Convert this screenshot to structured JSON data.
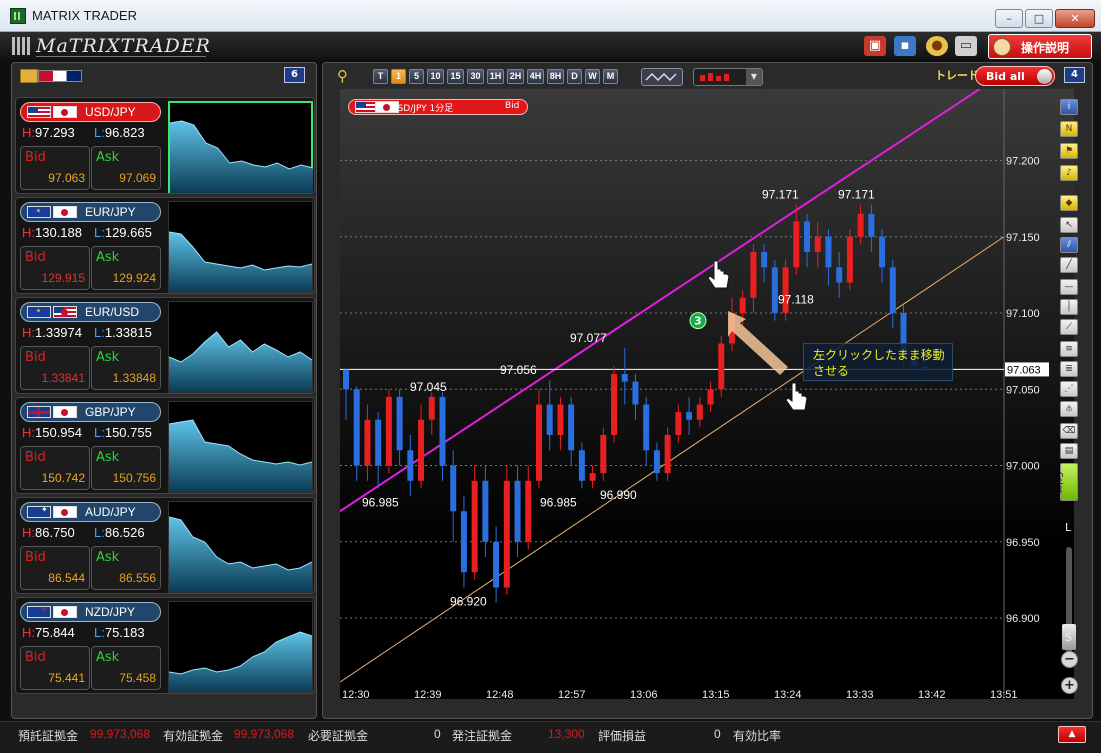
{
  "window": {
    "title": "MATRIX TRADER",
    "minimize": "–",
    "maximize": "□",
    "close": "✕"
  },
  "toolbar": {
    "logo": "MaTRIXTRADER",
    "help_label": "操作説明"
  },
  "left_panel": {
    "count": "6",
    "pairs": [
      {
        "name": "USD/JPY",
        "flag1": "us",
        "flag2": "jp",
        "high": "97.293",
        "low": "96.823",
        "bid": "97.063",
        "ask": "97.069",
        "selected": true
      },
      {
        "name": "EUR/JPY",
        "flag1": "eu",
        "flag2": "jp",
        "high": "130.188",
        "low": "129.665",
        "bid": "129.915",
        "ask": "129.924"
      },
      {
        "name": "EUR/USD",
        "flag1": "eu",
        "flag2": "us",
        "high": "1.33974",
        "low": "1.33815",
        "bid": "1.33841",
        "ask": "1.33848"
      },
      {
        "name": "GBP/JPY",
        "flag1": "gb",
        "flag2": "jp",
        "high": "150.954",
        "low": "150.755",
        "bid": "150.742",
        "ask": "150.756"
      },
      {
        "name": "AUD/JPY",
        "flag1": "au",
        "flag2": "jp",
        "high": "86.750",
        "low": "86.526",
        "bid": "86.544",
        "ask": "86.556"
      },
      {
        "name": "NZD/JPY",
        "flag1": "nz",
        "flag2": "jp",
        "high": "75.844",
        "low": "75.183",
        "bid": "75.441",
        "ask": "75.458"
      }
    ],
    "labels": {
      "high": "H:",
      "low": "L:",
      "bid": "Bid",
      "ask": "Ask"
    }
  },
  "chart_toolbar": {
    "timeframes": [
      "T",
      "1",
      "5",
      "10",
      "15",
      "30",
      "1H",
      "2H",
      "4H",
      "8H",
      "D",
      "W",
      "M"
    ],
    "active_timeframe": "1",
    "trade_label": "トレード",
    "bid_all_label": "Bid all",
    "count": "4"
  },
  "chart": {
    "tag_text": "USD/JPY 1分足",
    "tag_side": "Bid",
    "hint": "左クリックしたまま移動させる",
    "badge": "3",
    "zoom_l": "L",
    "zoom_s": "S"
  },
  "chart_data": {
    "type": "candlestick",
    "title": "USD/JPY 1分足",
    "y_axis": {
      "ticks": [
        "97.200",
        "97.150",
        "97.100",
        "97.050",
        "97.000",
        "96.950",
        "96.900"
      ],
      "ylim": [
        96.86,
        97.26
      ]
    },
    "x_axis": {
      "ticks": [
        "12:30",
        "12:39",
        "12:48",
        "12:57",
        "13:06",
        "13:15",
        "13:24",
        "13:33",
        "13:42",
        "13:51"
      ]
    },
    "current_price": "97.063",
    "annotations": [
      {
        "text": "97.045",
        "value": 97.045
      },
      {
        "text": "96.985",
        "value": 96.985
      },
      {
        "text": "97.056",
        "value": 97.056
      },
      {
        "text": "96.920",
        "value": 96.92
      },
      {
        "text": "97.077",
        "value": 97.077
      },
      {
        "text": "96.985",
        "value": 96.985
      },
      {
        "text": "96.990",
        "value": 96.99
      },
      {
        "text": "97.171",
        "value": 97.171
      },
      {
        "text": "97.118",
        "value": 97.118
      },
      {
        "text": "97.171",
        "value": 97.171
      }
    ],
    "candles": [
      [
        97.063,
        97.05,
        97.03,
        97.06
      ],
      [
        97.05,
        97.0,
        96.99,
        97.052
      ],
      [
        97.0,
        97.03,
        96.99,
        97.04
      ],
      [
        97.03,
        97.0,
        96.985,
        97.035
      ],
      [
        97.0,
        97.045,
        96.995,
        97.05
      ],
      [
        97.045,
        97.01,
        97.0,
        97.05
      ],
      [
        97.01,
        96.99,
        96.98,
        97.02
      ],
      [
        96.99,
        97.03,
        96.985,
        97.04
      ],
      [
        97.03,
        97.045,
        97.02,
        97.048
      ],
      [
        97.045,
        97.0,
        96.99,
        97.048
      ],
      [
        97.0,
        96.97,
        96.95,
        97.01
      ],
      [
        96.97,
        96.93,
        96.92,
        96.98
      ],
      [
        96.93,
        96.99,
        96.925,
        97.0
      ],
      [
        96.99,
        96.95,
        96.94,
        97.0
      ],
      [
        96.95,
        96.92,
        96.91,
        96.96
      ],
      [
        96.92,
        96.99,
        96.915,
        97.0
      ],
      [
        96.99,
        96.95,
        96.94,
        97.0
      ],
      [
        96.95,
        96.99,
        96.945,
        97.0
      ],
      [
        96.99,
        97.04,
        96.985,
        97.05
      ],
      [
        97.04,
        97.02,
        97.01,
        97.056
      ],
      [
        97.02,
        97.04,
        97.01,
        97.045
      ],
      [
        97.04,
        97.01,
        97.0,
        97.045
      ],
      [
        97.01,
        96.99,
        96.985,
        97.015
      ],
      [
        96.99,
        96.995,
        96.985,
        97.0
      ],
      [
        96.995,
        97.02,
        96.99,
        97.025
      ],
      [
        97.02,
        97.06,
        97.015,
        97.065
      ],
      [
        97.06,
        97.055,
        97.04,
        97.077
      ],
      [
        97.055,
        97.04,
        97.03,
        97.06
      ],
      [
        97.04,
        97.01,
        97.0,
        97.045
      ],
      [
        97.01,
        96.995,
        96.99,
        97.015
      ],
      [
        96.995,
        97.02,
        96.99,
        97.025
      ],
      [
        97.02,
        97.035,
        97.015,
        97.04
      ],
      [
        97.035,
        97.03,
        97.02,
        97.045
      ],
      [
        97.03,
        97.04,
        97.025,
        97.045
      ],
      [
        97.04,
        97.05,
        97.035,
        97.055
      ],
      [
        97.05,
        97.08,
        97.045,
        97.085
      ],
      [
        97.08,
        97.1,
        97.075,
        97.11
      ],
      [
        97.1,
        97.11,
        97.09,
        97.115
      ],
      [
        97.11,
        97.14,
        97.1,
        97.145
      ],
      [
        97.14,
        97.13,
        97.12,
        97.145
      ],
      [
        97.13,
        97.1,
        97.095,
        97.135
      ],
      [
        97.1,
        97.13,
        97.095,
        97.135
      ],
      [
        97.13,
        97.16,
        97.125,
        97.171
      ],
      [
        97.16,
        97.14,
        97.13,
        97.165
      ],
      [
        97.14,
        97.15,
        97.13,
        97.16
      ],
      [
        97.15,
        97.13,
        97.118,
        97.155
      ],
      [
        97.13,
        97.12,
        97.11,
        97.14
      ],
      [
        97.12,
        97.15,
        97.115,
        97.155
      ],
      [
        97.15,
        97.165,
        97.145,
        97.171
      ],
      [
        97.165,
        97.15,
        97.14,
        97.171
      ],
      [
        97.15,
        97.13,
        97.12,
        97.155
      ],
      [
        97.13,
        97.1,
        97.09,
        97.135
      ],
      [
        97.1,
        97.07,
        97.065,
        97.105
      ],
      [
        97.07,
        97.065,
        97.06,
        97.075
      ],
      [
        97.065,
        97.063,
        97.06,
        97.07
      ]
    ]
  },
  "status_bar": {
    "deposit_label": "預託証拠金",
    "deposit_value": "99,973,068",
    "valid_label": "有効証拠金",
    "valid_value": "99,973,068",
    "required_label": "必要証拠金",
    "required_value": "0",
    "ordered_label": "発注証拠金",
    "ordered_value": "13,300",
    "pnl_label": "評価損益",
    "pnl_value": "0",
    "ratio_label": "有効比率"
  }
}
